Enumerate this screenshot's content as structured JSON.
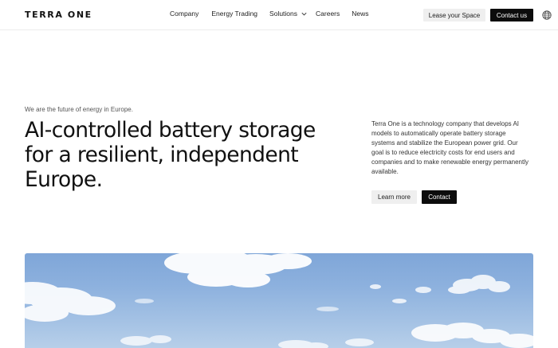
{
  "header": {
    "logo": "TERRA ONE",
    "nav": [
      {
        "label": "Company"
      },
      {
        "label": "Energy Trading"
      },
      {
        "label": "Solutions"
      },
      {
        "label": "Careers"
      },
      {
        "label": "News"
      }
    ],
    "lease_button": "Lease your Space",
    "contact_button": "Contact us",
    "icons": {
      "solutions_dropdown": "chevron-down-icon",
      "language": "globe-icon"
    }
  },
  "hero": {
    "kicker": "We are the future of energy in Europe.",
    "headline": "AI-controlled battery storage for a resilient, independent Europe.",
    "description": "Terra One is a technology company that develops AI models to automatically operate battery storage systems and stabilize the European power grid. Our goal is to reduce electricity costs for end users and companies and to make renewable energy permanently available.",
    "learn_more_button": "Learn more",
    "contact_button": "Contact"
  },
  "colors": {
    "primary_button": "#0c0c0c",
    "secondary_button": "#efefef",
    "sky": "#8db1de"
  }
}
